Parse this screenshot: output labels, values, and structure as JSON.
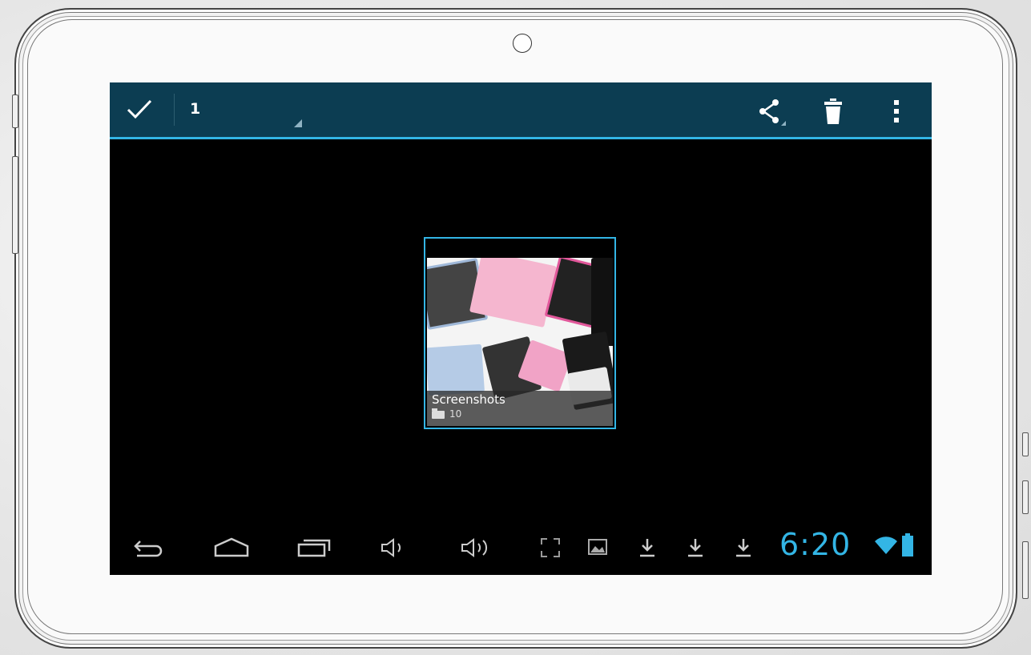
{
  "action_bar": {
    "selected_count": "1",
    "accent_color": "#33b5e5",
    "background_color": "#0c3d52",
    "icons": [
      "check-icon",
      "share-icon",
      "trash-icon",
      "overflow-menu-icon"
    ]
  },
  "album": {
    "name": "Screenshots",
    "count": "10"
  },
  "status": {
    "time": "6:20",
    "icons": [
      "wifi-icon",
      "battery-icon"
    ]
  },
  "navigation": {
    "icons": [
      "back-icon",
      "home-icon",
      "recent-apps-icon",
      "volume-down-icon",
      "volume-up-icon",
      "fullscreen-icon",
      "gallery-notification-icon",
      "download-icon",
      "download-icon",
      "download-icon"
    ]
  }
}
